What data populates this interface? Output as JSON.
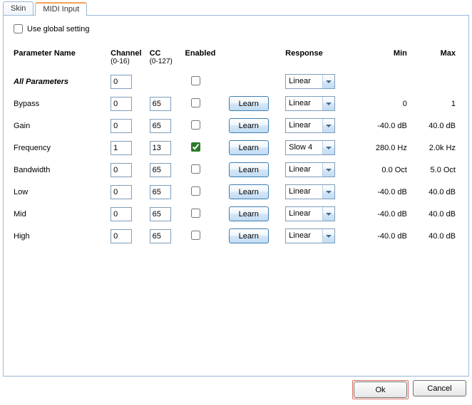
{
  "tabs": {
    "skin": "Skin",
    "midi": "MIDI Input"
  },
  "global_label": "Use global setting",
  "headers": {
    "param": "Parameter Name",
    "channel": "Channel",
    "channel_sub": "(0-16)",
    "cc": "CC",
    "cc_sub": "(0-127)",
    "enabled": "Enabled",
    "response": "Response",
    "min": "Min",
    "max": "Max"
  },
  "all_params_label": "All Parameters",
  "learn_label": "Learn",
  "all_row": {
    "channel": "0",
    "response": "Linear"
  },
  "rows": [
    {
      "name": "Bypass",
      "channel": "0",
      "cc": "65",
      "enabled": false,
      "response": "Linear",
      "min": "0",
      "max": "1"
    },
    {
      "name": "Gain",
      "channel": "0",
      "cc": "65",
      "enabled": false,
      "response": "Linear",
      "min": "-40.0 dB",
      "max": "40.0 dB"
    },
    {
      "name": "Frequency",
      "channel": "1",
      "cc": "13",
      "enabled": true,
      "response": "Slow 4",
      "min": "280.0 Hz",
      "max": "2.0k Hz"
    },
    {
      "name": "Bandwidth",
      "channel": "0",
      "cc": "65",
      "enabled": false,
      "response": "Linear",
      "min": "0.0 Oct",
      "max": "5.0 Oct"
    },
    {
      "name": "Low",
      "channel": "0",
      "cc": "65",
      "enabled": false,
      "response": "Linear",
      "min": "-40.0 dB",
      "max": "40.0 dB"
    },
    {
      "name": "Mid",
      "channel": "0",
      "cc": "65",
      "enabled": false,
      "response": "Linear",
      "min": "-40.0 dB",
      "max": "40.0 dB"
    },
    {
      "name": "High",
      "channel": "0",
      "cc": "65",
      "enabled": false,
      "response": "Linear",
      "min": "-40.0 dB",
      "max": "40.0 dB"
    }
  ],
  "buttons": {
    "ok": "Ok",
    "cancel": "Cancel"
  }
}
